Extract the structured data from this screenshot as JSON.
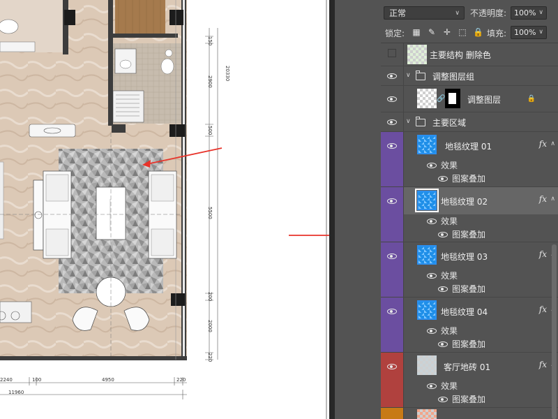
{
  "canvas": {
    "dims": {
      "right_vertical": [
        "150",
        "2900",
        "500",
        "5500",
        "200",
        "2000",
        "220"
      ],
      "right_total": "20330",
      "bottom": [
        "2240",
        "100",
        "4950",
        "220"
      ],
      "bottom_total": "11960"
    }
  },
  "layers_panel": {
    "blend_mode": "正常",
    "opacity_label": "不透明度:",
    "opacity_value": "100%",
    "lock_label": "锁定:",
    "fill_label": "填充:",
    "fill_value": "100%",
    "layers": [
      {
        "name": "主要结构 删除色",
        "visible": false,
        "type": "layer"
      },
      {
        "name": "调整图层组",
        "visible": true,
        "type": "group",
        "expanded": true
      },
      {
        "name": "调整图层",
        "visible": true,
        "type": "adjustment",
        "locked": true
      },
      {
        "name": "主要区域",
        "visible": true,
        "type": "group",
        "expanded": true
      },
      {
        "name": "地毯纹理 01",
        "visible": true,
        "label_color": "#6b4ea0",
        "fx": "fx",
        "effects_label": "效果",
        "effect": "图案叠加"
      },
      {
        "name": "地毯纹理 02",
        "visible": true,
        "label_color": "#6b4ea0",
        "fx": "fx",
        "effects_label": "效果",
        "effect": "图案叠加",
        "selected": true
      },
      {
        "name": "地毯纹理 03",
        "visible": true,
        "label_color": "#6b4ea0",
        "fx": "fx",
        "effects_label": "效果",
        "effect": "图案叠加"
      },
      {
        "name": "地毯纹理 04",
        "visible": true,
        "label_color": "#6b4ea0",
        "fx": "fx",
        "effects_label": "效果",
        "effect": "图案叠加"
      },
      {
        "name": "客厅地砖 01",
        "visible": true,
        "label_color": "#b0413e",
        "fx": "fx",
        "effects_label": "效果",
        "effect": "图案叠加"
      }
    ]
  },
  "colors": {
    "panel_bg": "#535353",
    "purple_label": "#6b4ea0",
    "red_label": "#b0413e",
    "orange_label": "#c77a16",
    "arrow_red": "#e8332a",
    "selected_row": "#666666"
  }
}
